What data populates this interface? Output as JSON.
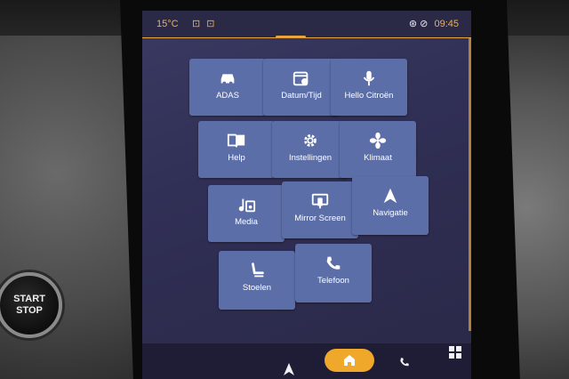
{
  "status": {
    "temperature": "15°C",
    "seat_icons": "⊡ ⊡",
    "status_icons": "⊛ ⊘",
    "time": "09:45"
  },
  "start_button": {
    "line1": "START",
    "line2": "STOP"
  },
  "tiles": [
    {
      "label": "ADAS",
      "icon": "car-icon"
    },
    {
      "label": "Datum/Tijd",
      "icon": "calendar-clock-icon"
    },
    {
      "label": "Hello Citroën",
      "icon": "microphone-icon"
    },
    {
      "label": "Help",
      "icon": "book-icon"
    },
    {
      "label": "Instellingen",
      "icon": "gear-icon"
    },
    {
      "label": "Klimaat",
      "icon": "fan-icon"
    },
    {
      "label": "Media",
      "icon": "music-icon"
    },
    {
      "label": "Mirror Screen",
      "icon": "mirror-screen-icon"
    },
    {
      "label": "Navigatie",
      "icon": "navigation-arrow-icon"
    },
    {
      "label": "Stoelen",
      "icon": "seat-icon"
    },
    {
      "label": "Telefoon",
      "icon": "phone-icon"
    }
  ],
  "colors": {
    "accent": "#f0a82a",
    "tile": "#5c6ea8",
    "screen_bg": "#302f55"
  }
}
